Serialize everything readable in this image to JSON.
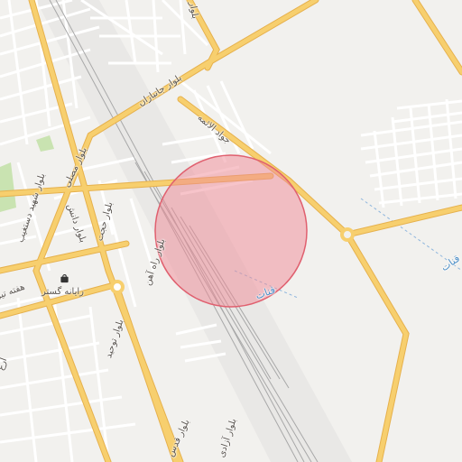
{
  "map": {
    "colors": {
      "background": "#f2f1ee",
      "major_road": "#f7cf6e",
      "major_road_casing": "#e8b24e",
      "minor_road": "#ffffff",
      "railway": "#9a9a9a",
      "water_line": "#8fb6dd",
      "park": "#c9e3b1",
      "highlight_fill": "#f08a96",
      "highlight_stroke": "#e0606f"
    },
    "highlight": {
      "shape": "circle",
      "label": ""
    },
    "labels": {
      "road_janbazan": "بلوار جانبازان",
      "road_jawad_aimma": "جواد الائمه",
      "road_mostafa": "بلوار مصلی",
      "road_hojjat": "بلوار حجت",
      "road_shahid_dastghib": "بلوار شهید دستغیب",
      "road_daneshgah": "بلوار دانش",
      "road_rahahan": "بلوار راه آهن",
      "road_haft_tir": "هفته تیر",
      "road_tohid": "بلوار توحید",
      "road_azadi": "بلوار آزادی",
      "road_qods": "بلوار قدس",
      "road_north": "بلوار",
      "road_arghavan": "ارغ",
      "canal_1": "قنات",
      "canal_2": "قنات"
    },
    "poi": {
      "name": "رایانه گستر",
      "icon": "shopping-bag-icon"
    }
  }
}
